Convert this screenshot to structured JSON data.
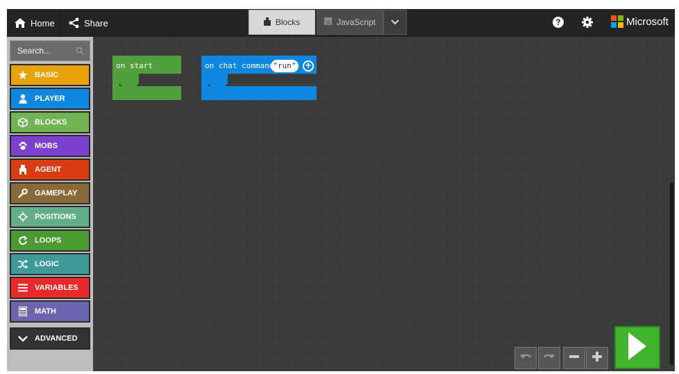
{
  "menubar": {
    "home_label": "Home",
    "share_label": "Share",
    "tabs": [
      {
        "label": "Blocks"
      },
      {
        "label": "JavaScript"
      }
    ],
    "help_label": "?",
    "brand_label": "Microsoft"
  },
  "toolbox": {
    "search_placeholder": "Search...",
    "categories": [
      {
        "label": "BASIC",
        "color": "#e8a20b",
        "icon": "star-icon"
      },
      {
        "label": "PLAYER",
        "color": "#0d87e0",
        "icon": "person-icon"
      },
      {
        "label": "BLOCKS",
        "color": "#72b455",
        "icon": "cube-icon"
      },
      {
        "label": "MOBS",
        "color": "#7c3fcf",
        "icon": "paw-icon"
      },
      {
        "label": "AGENT",
        "color": "#d93b13",
        "icon": "agent-icon"
      },
      {
        "label": "GAMEPLAY",
        "color": "#8a6a38",
        "icon": "wrench-icon"
      },
      {
        "label": "POSITIONS",
        "color": "#62ae89",
        "icon": "crosshair-icon"
      },
      {
        "label": "LOOPS",
        "color": "#4b9a31",
        "icon": "loop-icon"
      },
      {
        "label": "LOGIC",
        "color": "#3e9b98",
        "icon": "shuffle-icon"
      },
      {
        "label": "VARIABLES",
        "color": "#e8292a",
        "icon": "list-icon"
      },
      {
        "label": "MATH",
        "color": "#6b64b0",
        "icon": "calculator-icon"
      },
      {
        "label": "ADVANCED",
        "color": "#333333",
        "icon": "chevron-down-icon"
      }
    ]
  },
  "workspace": {
    "blocks": [
      {
        "label": "on start",
        "color": "#51a03d"
      },
      {
        "label": "on chat command",
        "arg": "\"run\"",
        "color": "#0d87e0"
      }
    ]
  },
  "controls": {
    "undo": "undo-icon",
    "redo": "redo-icon",
    "zoom_out": "minus-icon",
    "zoom_in": "plus-icon",
    "run": "play-icon"
  }
}
